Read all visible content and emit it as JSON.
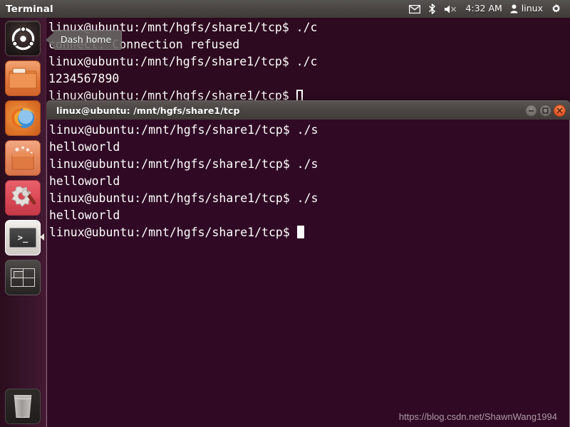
{
  "panel": {
    "app_title": "Terminal",
    "indicators": [
      {
        "name": "messaging-icon",
        "label": "✉"
      },
      {
        "name": "bluetooth-icon",
        "label": "ᛦ"
      },
      {
        "name": "volume-muted-icon",
        "label": "🔇"
      }
    ],
    "clock": "4:32 AM",
    "user": "linux",
    "session_icon": "gear-icon"
  },
  "launcher": {
    "items": [
      {
        "name": "dash-home",
        "label": "Dash home"
      },
      {
        "name": "files",
        "label": "Files"
      },
      {
        "name": "firefox",
        "label": "Firefox Web Browser"
      },
      {
        "name": "software-center",
        "label": "Ubuntu Software Center"
      },
      {
        "name": "system-settings",
        "label": "System Settings"
      },
      {
        "name": "terminal",
        "label": "Terminal"
      },
      {
        "name": "workspace-switcher",
        "label": "Workspace Switcher"
      },
      {
        "name": "trash",
        "label": "Trash"
      }
    ]
  },
  "tooltip": {
    "text": "Dash home"
  },
  "background_terminal": {
    "lines": [
      "linux@ubuntu:/mnt/hgfs/share1/tcp$ ./c",
      "connect: Connection refused",
      "linux@ubuntu:/mnt/hgfs/share1/tcp$ ./c",
      "1234567890",
      "linux@ubuntu:/mnt/hgfs/share1/tcp$ "
    ]
  },
  "foreground_window": {
    "title": "linux@ubuntu: /mnt/hgfs/share1/tcp",
    "controls": {
      "minimize": "minimize-button",
      "maximize": "maximize-button",
      "close": "close-button"
    },
    "lines": [
      "linux@ubuntu:/mnt/hgfs/share1/tcp$ ./s",
      "helloworld",
      "linux@ubuntu:/mnt/hgfs/share1/tcp$ ./s",
      "helloworld",
      "linux@ubuntu:/mnt/hgfs/share1/tcp$ ./s",
      "helloworld",
      "linux@ubuntu:/mnt/hgfs/share1/tcp$ "
    ]
  },
  "watermark": {
    "text": "https://blog.csdn.net/ShawnWang1994"
  },
  "colors": {
    "terminal_bg": "#300a24",
    "panel_bg": "#413c39",
    "close_button": "#e2572a",
    "launcher_bg": "#37142a"
  }
}
